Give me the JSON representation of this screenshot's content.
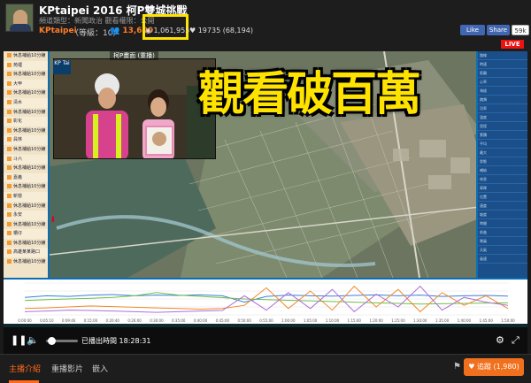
{
  "header": {
    "title": "KPtaipei 2016 柯P雙城挑戰",
    "meta": "頻道類型：新聞政治   觀看權限：公開",
    "channel_name": "KPtaipei",
    "level": "（等級：10）",
    "followers": "13,600",
    "views": "1,061,955",
    "likes": "19735 (68,194)",
    "fb_like": "Like",
    "fb_share": "Share",
    "fb_count": "59k",
    "live_badge": "LIVE"
  },
  "video": {
    "camera_label": "柯P畫面 (重播)",
    "headline": "觀看破百萬",
    "inset_tag": "KP Tai",
    "sidebar_items": [
      "休息補給10分鐘",
      "苑裡",
      "休息補給10分鐘",
      "大甲",
      "休息補給10分鐘",
      "清水",
      "休息補給10分鐘",
      "彰化",
      "休息補給10分鐘",
      "員林",
      "休息補給10分鐘",
      "斗六",
      "休息補給10分鐘",
      "嘉義",
      "休息補給10分鐘",
      "新營",
      "休息補給10分鐘",
      "永安",
      "休息補給10分鐘",
      "橋仔",
      "休息補給10分鐘",
      "高雄某某路口",
      "休息補給10分鐘"
    ],
    "right_items": [
      "路線",
      "時速",
      "距離",
      "心率",
      "海拔",
      "踏頻",
      "功率",
      "溫度",
      "里程",
      "累積",
      "平均",
      "最大",
      "狀態",
      "補給",
      "休息",
      "車隊",
      "位置",
      "速度",
      "坡度",
      "時間",
      "前進",
      "隊員",
      "天氣",
      "風速"
    ]
  },
  "chart_data": {
    "type": "line",
    "title": "",
    "xlabel": "",
    "ylabel": "",
    "ylim": [
      0,
      100
    ],
    "x": [
      "0:00:00",
      "0:05:10",
      "0:09:46",
      "0:15:00",
      "0:20:40",
      "0:26:00",
      "0:30:00",
      "0:35:00",
      "0:40:00",
      "0:45:00",
      "0:50:00",
      "0:55:00",
      "1:00:00",
      "1:05:00",
      "1:10:00",
      "1:15:00",
      "1:20:00",
      "1:25:00",
      "1:30:00",
      "1:35:00",
      "1:40:00",
      "1:45:00",
      "1:50:00"
    ],
    "series": [
      {
        "values": [
          55,
          60,
          58,
          62,
          64,
          60,
          62,
          61,
          63,
          60,
          40,
          58,
          62,
          60,
          59,
          61,
          63,
          60,
          62,
          58,
          60,
          61,
          59
        ]
      },
      {
        "values": [
          45,
          48,
          50,
          52,
          55,
          60,
          70,
          62,
          58,
          54,
          50,
          48,
          46,
          44,
          42,
          40,
          38,
          36,
          34,
          35,
          36,
          37,
          38
        ]
      },
      {
        "values": [
          20,
          22,
          25,
          28,
          26,
          24,
          22,
          20,
          18,
          20,
          30,
          85,
          20,
          75,
          15,
          90,
          25,
          80,
          10,
          70,
          30,
          60,
          20
        ]
      },
      {
        "values": [
          10,
          12,
          15,
          14,
          12,
          10,
          8,
          10,
          12,
          14,
          60,
          15,
          70,
          20,
          80,
          10,
          65,
          25,
          90,
          15,
          55,
          40,
          30
        ]
      }
    ]
  },
  "controls": {
    "play_icon": "pause-icon",
    "played_time": "已播出時間  18:28:31"
  },
  "tabs": {
    "intro": "主播介紹",
    "replay": "重播影片",
    "embed": "嵌入",
    "follow": "追蹤 (1,980)"
  },
  "colors": {
    "accent": "#f0701e",
    "highlight": "#ffe300",
    "live": "#ee1111"
  }
}
